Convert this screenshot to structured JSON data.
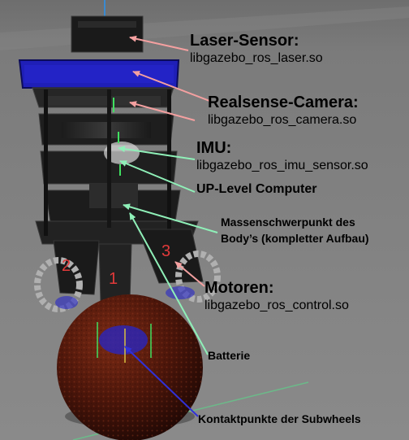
{
  "annotations": {
    "laser": {
      "title": "Laser-Sensor:",
      "subtitle": "libgazebo_ros_laser.so"
    },
    "realsense": {
      "title": "Realsense-Camera:",
      "subtitle": "libgazebo_ros_camera.so"
    },
    "imu": {
      "title": "IMU:",
      "subtitle": "libgazebo_ros_imu_sensor.so"
    },
    "upboard": {
      "title": "UP-Level Computer"
    },
    "com": {
      "line1": "Massenschwerpunkt des",
      "line2": "Body’s (kompletter Aufbau)"
    },
    "motors": {
      "title": "Motoren:",
      "subtitle": "libgazebo_ros_control.so"
    },
    "battery": {
      "title": "Batterie"
    },
    "contacts": {
      "title": "Kontaktpunkte der Subwheels"
    }
  },
  "motor_numbers": [
    "1",
    "2",
    "3"
  ],
  "colors": {
    "background": "#7d7d7d",
    "laser_arrow": "#f4a0a0",
    "green_arrow": "#8ff0b8",
    "blue_arrow": "#3030d8",
    "motor_number": "#e23a3a",
    "laser_bar": "#1f1fb8"
  }
}
